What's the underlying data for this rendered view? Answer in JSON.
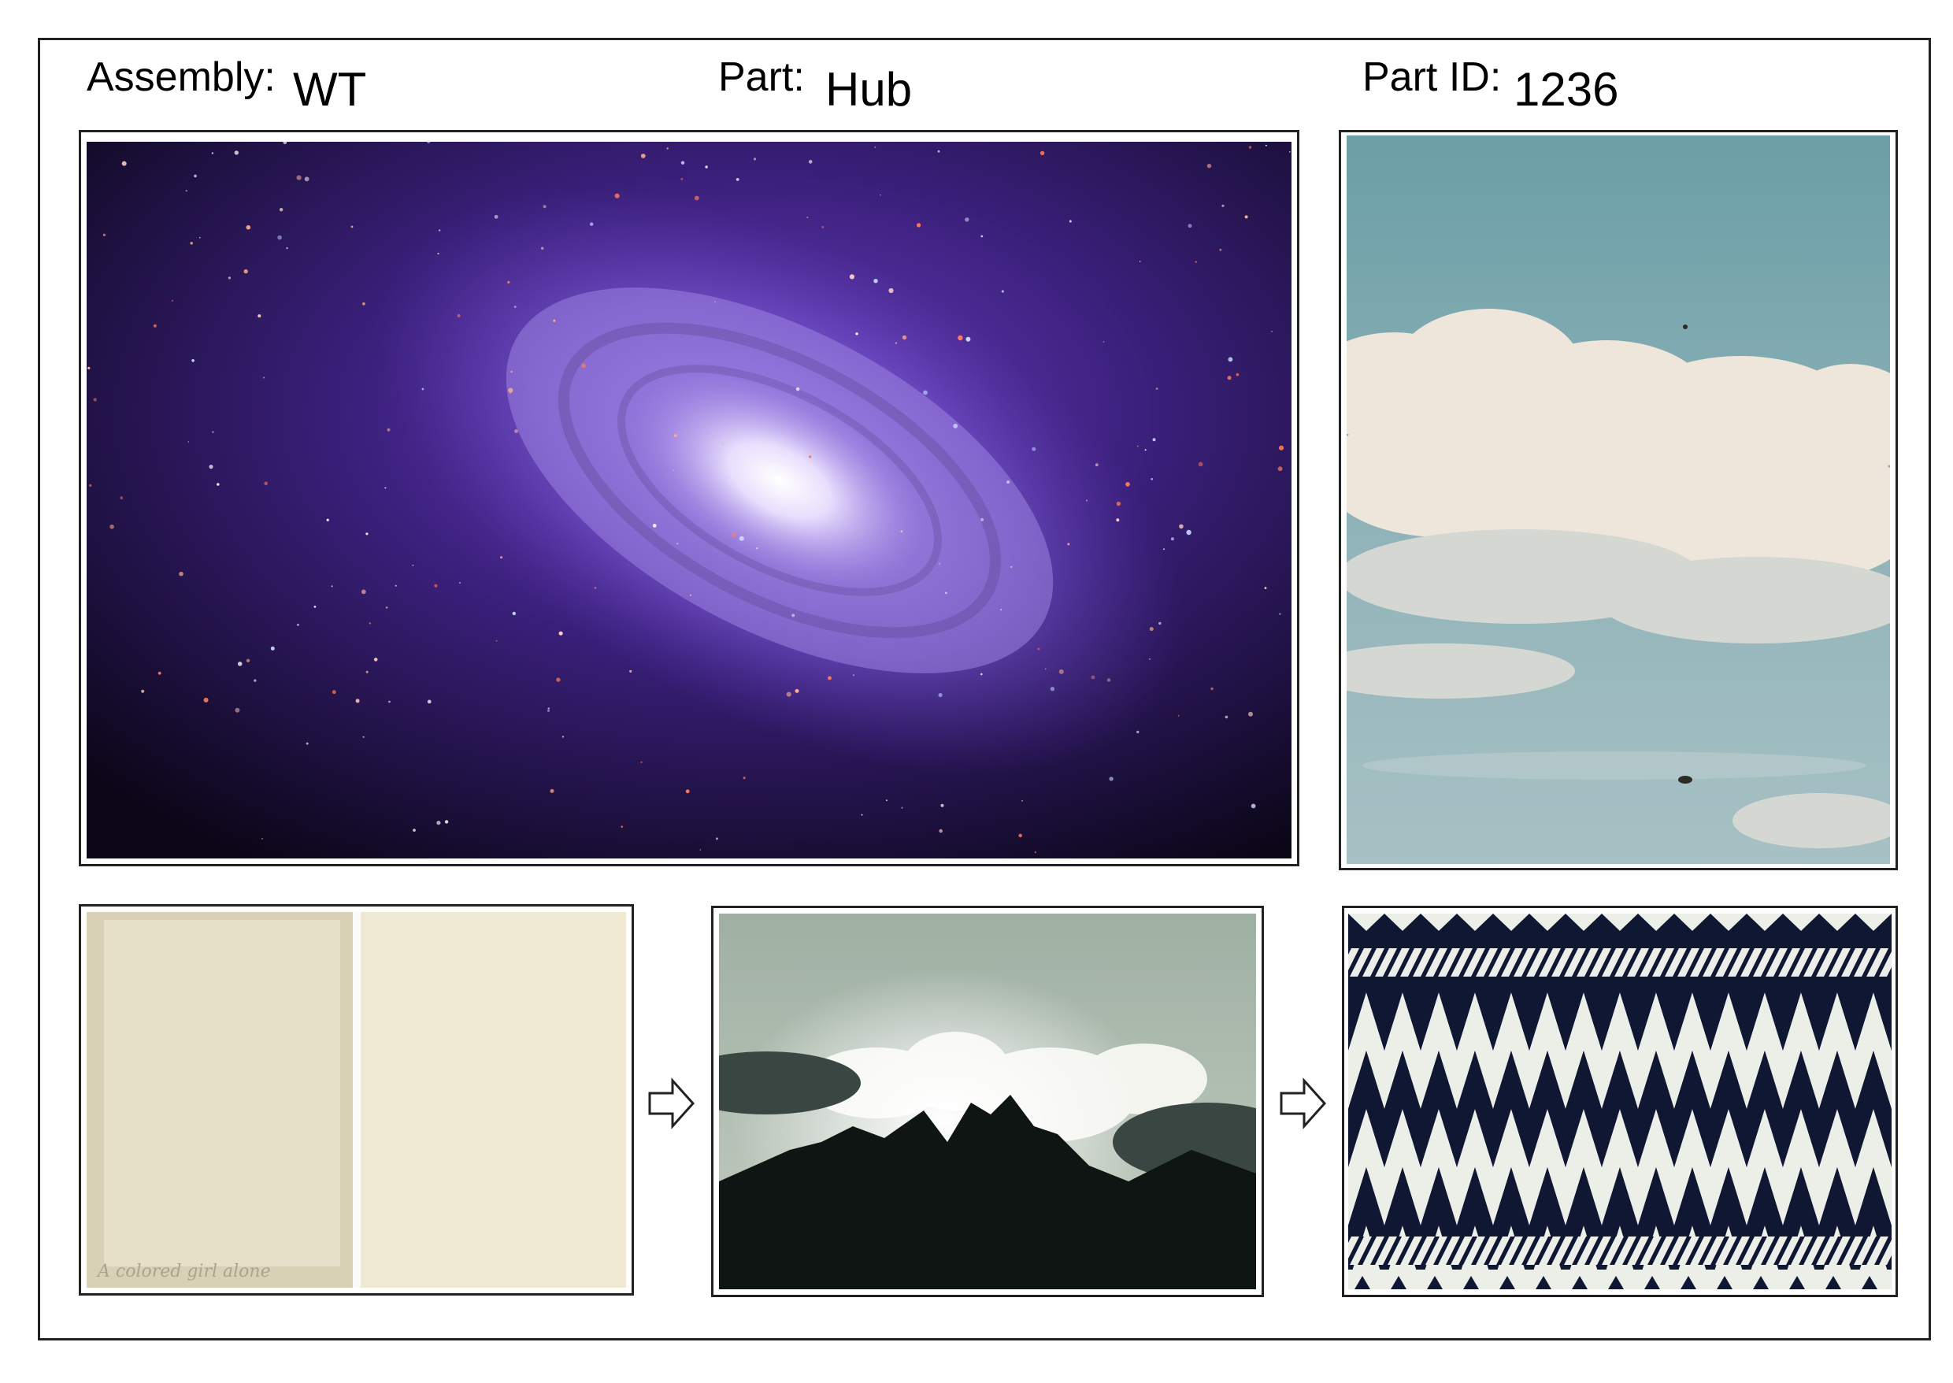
{
  "header": {
    "assembly_label": "Assembly:",
    "assembly_value": "WT",
    "part_label": "Part:",
    "part_value": "Hub",
    "part_id_label": "Part ID:",
    "part_id_value": "1236"
  },
  "images": {
    "main": "galaxy-photo",
    "side": "cloud-sky-photo",
    "step1": "aged-paper-card-photo",
    "step2": "mountain-clouds-photo",
    "step3": "triangle-pattern-photo"
  },
  "card_caption": "A colored girl alone"
}
